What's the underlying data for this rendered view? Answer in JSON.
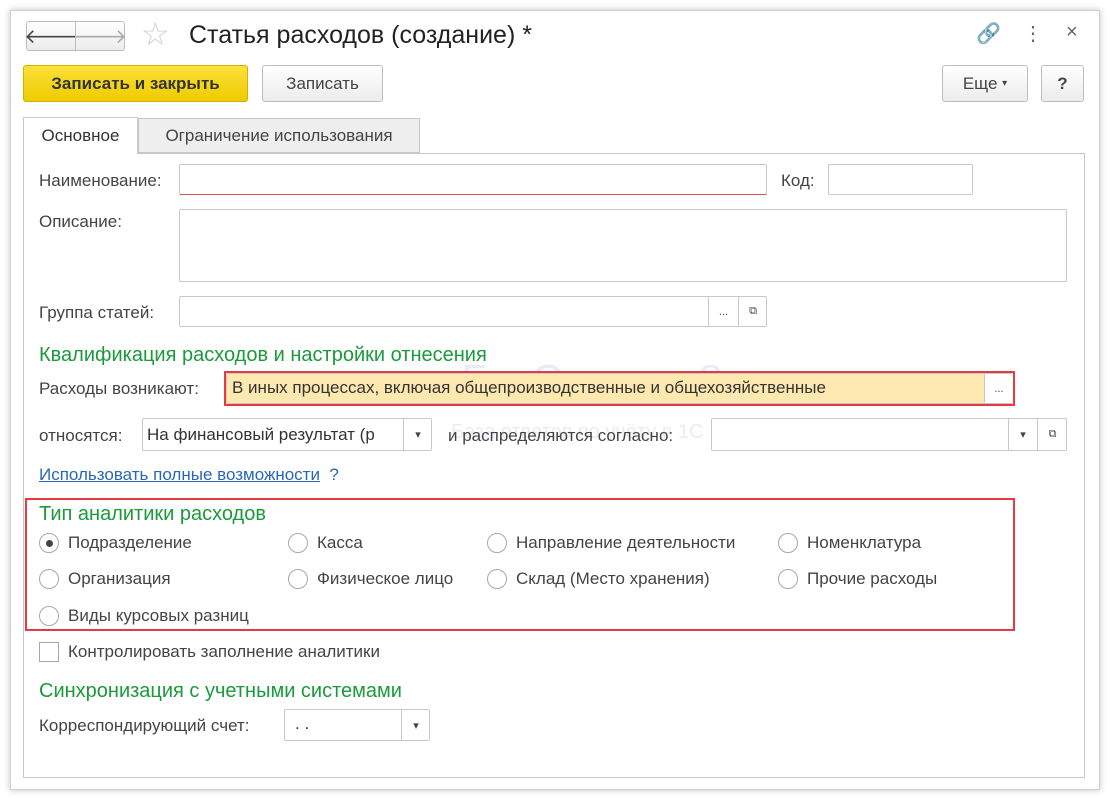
{
  "title": "Статья расходов (создание) *",
  "toolbar": {
    "save_close": "Записать и закрыть",
    "save": "Записать",
    "more": "Еще",
    "help": "?"
  },
  "tabs": [
    "Основное",
    "Ограничение использования"
  ],
  "form": {
    "name_label": "Наименование:",
    "name_value": "",
    "code_label": "Код:",
    "code_value": "",
    "desc_label": "Описание:",
    "desc_value": "",
    "group_label": "Группа статей:",
    "group_value": "",
    "section1": "Квалификация расходов и настройки отнесения",
    "arise_label": "Расходы возникают:",
    "arise_value": "В иных процессах, включая общепроизводственные и общехозяйственные",
    "relate_label": "относятся:",
    "relate_value": "На финансовый результат (р",
    "distrib_label": "и распределяются согласно:",
    "distrib_value": "",
    "full_link": "Использовать полные возможности",
    "full_help": "?",
    "section2": "Тип аналитики расходов",
    "radios": [
      "Подразделение",
      "Касса",
      "Направление деятельности",
      "Номенклатура",
      "Организация",
      "Физическое лицо",
      "Склад (Место хранения)",
      "Прочие расходы",
      "Виды курсовых разниц"
    ],
    "radio_selected": "Подразделение",
    "control_label": "Контролировать заполнение аналитики",
    "control_checked": false,
    "section3": "Синхронизация с учетными системами",
    "account_label": "Корреспондирующий счет:",
    "account_value": ". ."
  },
  "watermark": {
    "brand": "БухЭксперт8",
    "tagline": "База ответов по учёту в 1С"
  },
  "colors": {
    "accent": "#1a9a3a",
    "primary_button": "#f5d400",
    "highlight": "#fde9b0",
    "frame": "#e53a40",
    "link": "#2a66b8"
  }
}
